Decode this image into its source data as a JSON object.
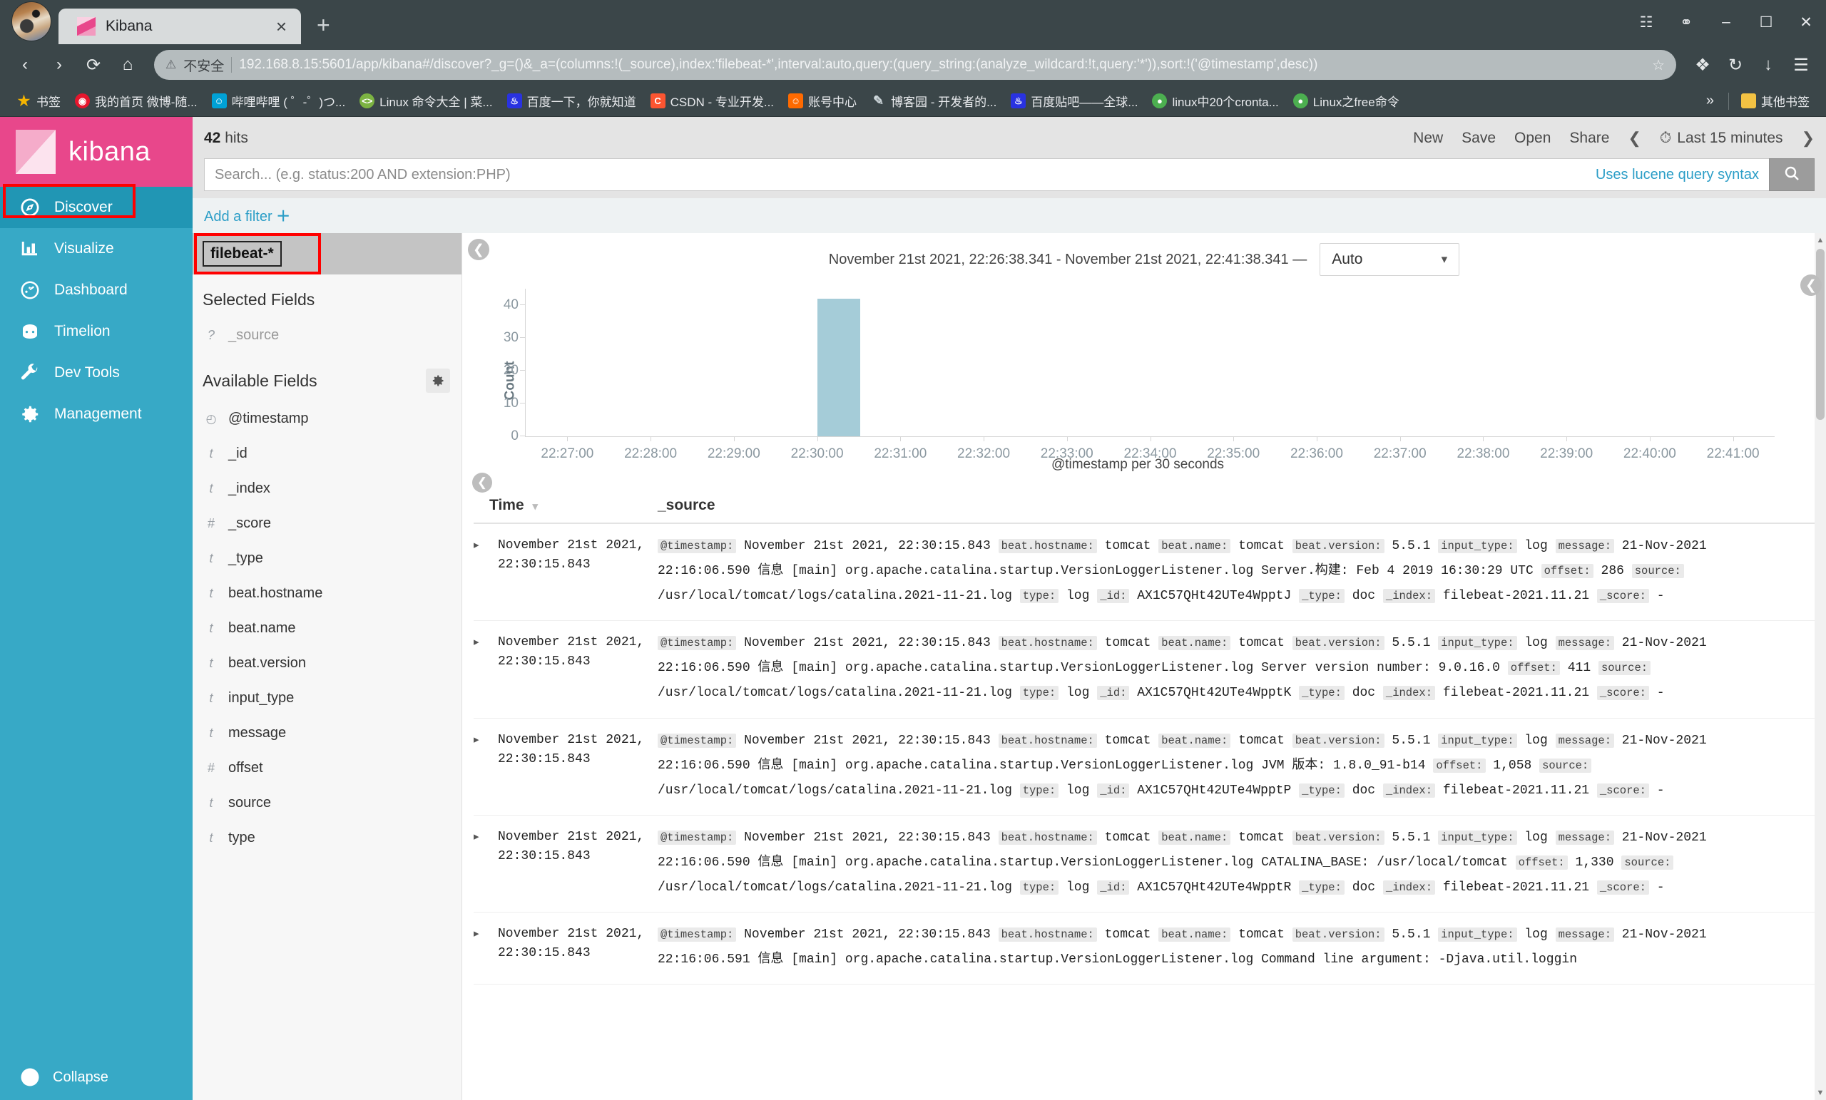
{
  "browser": {
    "tab": {
      "title": "Kibana",
      "favicon": "kibana-icon",
      "close": "×"
    },
    "newtab": "+",
    "window_controls": [
      "minimize",
      "maximize",
      "close"
    ],
    "nav": {
      "back": "‹",
      "forward": "›",
      "reload": "⟳",
      "home": "⌂"
    },
    "omnibox": {
      "warning_icon": "warning-triangle-icon",
      "insecure_label": "不安全",
      "url": "192.168.8.15:5601/app/kibana#/discover?_g=()&_a=(columns:!(_source),index:'filebeat-*',interval:auto,query:(query_string:(analyze_wildcard:!t,query:'*')),sort:!('@timestamp',desc))",
      "star_icon": "bookmark-star-icon"
    },
    "toolbar_right": [
      "cast-icon",
      "shield-icon",
      "extensions-icon",
      "menu-icon"
    ],
    "bookmarks": [
      {
        "label": "书签",
        "icon": "star-icon",
        "color": "#f5b400"
      },
      {
        "label": "我的首页 微博-随...",
        "icon": "weibo-icon",
        "color": "#e6162d"
      },
      {
        "label": "哔哩哔哩 ( ゜-゜)つ...",
        "icon": "bilibili-icon",
        "color": "#00a1d6"
      },
      {
        "label": "Linux 命令大全 | 菜...",
        "icon": "code-icon",
        "color": "#7cb342"
      },
      {
        "label": "百度一下，你就知道",
        "icon": "baidu-icon",
        "color": "#2932e1"
      },
      {
        "label": "CSDN - 专业开发...",
        "icon": "csdn-icon",
        "color": "#fc5531"
      },
      {
        "label": "账号中心",
        "icon": "account-icon",
        "color": "#ff6a00"
      },
      {
        "label": "博客园 - 开发者的...",
        "icon": "cnblogs-icon",
        "color": "#2b5f8e"
      },
      {
        "label": "百度贴吧——全球...",
        "icon": "baidu-tieba-icon",
        "color": "#2932e1"
      },
      {
        "label": "linux中20个cronta...",
        "icon": "leaf-icon",
        "color": "#4caf50"
      },
      {
        "label": "Linux之free命令",
        "icon": "leaf-icon",
        "color": "#4caf50"
      }
    ],
    "bookmarks_overflow": "»",
    "other_bookmarks": {
      "label": "其他书签",
      "icon": "folder-icon"
    }
  },
  "sidebar": {
    "logo_text": "kibana",
    "items": [
      {
        "label": "Discover",
        "icon": "compass-icon",
        "active": true
      },
      {
        "label": "Visualize",
        "icon": "bar-chart-icon",
        "active": false
      },
      {
        "label": "Dashboard",
        "icon": "dashboard-icon",
        "active": false
      },
      {
        "label": "Timelion",
        "icon": "timelion-icon",
        "active": false
      },
      {
        "label": "Dev Tools",
        "icon": "wrench-icon",
        "active": false
      },
      {
        "label": "Management",
        "icon": "gear-icon",
        "active": false
      }
    ],
    "collapse": {
      "label": "Collapse",
      "icon": "collapse-arrow-icon"
    }
  },
  "topbar": {
    "hits_count": "42",
    "hits_label": "hits",
    "actions": [
      "New",
      "Save",
      "Open",
      "Share"
    ],
    "time_prev": "❮",
    "time_next": "❯",
    "time_label": "Last 15 minutes",
    "clock_icon": "clock-icon"
  },
  "query": {
    "placeholder": "Search... (e.g. status:200 AND extension:PHP)",
    "value": "",
    "hint": "Uses lucene query syntax",
    "search_icon": "search-icon"
  },
  "filters": {
    "add_filter": "Add a filter",
    "plus": "＋"
  },
  "fields": {
    "index_pattern": "filebeat-*",
    "selected_title": "Selected Fields",
    "selected": [
      {
        "name": "_source",
        "type": "?"
      }
    ],
    "available_title": "Available Fields",
    "settings_icon": "gear-icon",
    "available": [
      {
        "name": "@timestamp",
        "type": "◴"
      },
      {
        "name": "_id",
        "type": "t"
      },
      {
        "name": "_index",
        "type": "t"
      },
      {
        "name": "_score",
        "type": "#"
      },
      {
        "name": "_type",
        "type": "t"
      },
      {
        "name": "beat.hostname",
        "type": "t"
      },
      {
        "name": "beat.name",
        "type": "t"
      },
      {
        "name": "beat.version",
        "type": "t"
      },
      {
        "name": "input_type",
        "type": "t"
      },
      {
        "name": "message",
        "type": "t"
      },
      {
        "name": "offset",
        "type": "#"
      },
      {
        "name": "source",
        "type": "t"
      },
      {
        "name": "type",
        "type": "t"
      }
    ]
  },
  "chart_header": {
    "range": "November 21st 2021, 22:26:38.341 - November 21st 2021, 22:41:38.341 —",
    "interval_value": "Auto",
    "interval_caret": "⌄"
  },
  "chart_data": {
    "type": "bar",
    "title": "",
    "xlabel": "@timestamp per 30 seconds",
    "ylabel": "Count",
    "ylim": [
      0,
      45
    ],
    "yticks": [
      0,
      10,
      20,
      30,
      40
    ],
    "grid": false,
    "legend": "none",
    "categories": [
      "22:27:00",
      "22:28:00",
      "22:29:00",
      "22:30:00",
      "22:31:00",
      "22:32:00",
      "22:33:00",
      "22:34:00",
      "22:35:00",
      "22:36:00",
      "22:37:00",
      "22:38:00",
      "22:39:00",
      "22:40:00",
      "22:41:00"
    ],
    "bar_color": "#a5ccd8",
    "bars": [
      {
        "x": "22:30:00",
        "value": 42
      }
    ],
    "values": [
      0,
      0,
      0,
      42,
      0,
      0,
      0,
      0,
      0,
      0,
      0,
      0,
      0,
      0,
      0
    ]
  },
  "doctable": {
    "columns": [
      "Time",
      "_source"
    ],
    "sort_caret": "▾",
    "expand_caret": "▸",
    "rows": [
      {
        "time": "November 21st 2021, 22:30:15.843",
        "source": [
          {
            "k": "@timestamp:",
            "v": "November 21st 2021, 22:30:15.843"
          },
          {
            "k": "beat.hostname:",
            "v": "tomcat"
          },
          {
            "k": "beat.name:",
            "v": "tomcat"
          },
          {
            "k": "beat.version:",
            "v": "5.5.1"
          },
          {
            "k": "input_type:",
            "v": "log"
          },
          {
            "k": "message:",
            "v": "21-Nov-2021 22:16:06.590 信息 [main] org.apache.catalina.startup.VersionLoggerListener.log Server.构建: Feb 4 2019 16:30:29 UTC"
          },
          {
            "k": "offset:",
            "v": "286"
          },
          {
            "k": "source:",
            "v": "/usr/local/tomcat/logs/catalina.2021-11-21.log"
          },
          {
            "k": "type:",
            "v": "log"
          },
          {
            "k": "_id:",
            "v": "AX1C57QHt42UTe4WpptJ"
          },
          {
            "k": "_type:",
            "v": "doc"
          },
          {
            "k": "_index:",
            "v": "filebeat-2021.11.21"
          },
          {
            "k": "_score:",
            "v": "-"
          }
        ]
      },
      {
        "time": "November 21st 2021, 22:30:15.843",
        "source": [
          {
            "k": "@timestamp:",
            "v": "November 21st 2021, 22:30:15.843"
          },
          {
            "k": "beat.hostname:",
            "v": "tomcat"
          },
          {
            "k": "beat.name:",
            "v": "tomcat"
          },
          {
            "k": "beat.version:",
            "v": "5.5.1"
          },
          {
            "k": "input_type:",
            "v": "log"
          },
          {
            "k": "message:",
            "v": "21-Nov-2021 22:16:06.590 信息 [main] org.apache.catalina.startup.VersionLoggerListener.log Server version number: 9.0.16.0"
          },
          {
            "k": "offset:",
            "v": "411"
          },
          {
            "k": "source:",
            "v": "/usr/local/tomcat/logs/catalina.2021-11-21.log"
          },
          {
            "k": "type:",
            "v": "log"
          },
          {
            "k": "_id:",
            "v": "AX1C57QHt42UTe4WpptK"
          },
          {
            "k": "_type:",
            "v": "doc"
          },
          {
            "k": "_index:",
            "v": "filebeat-2021.11.21"
          },
          {
            "k": "_score:",
            "v": "-"
          }
        ]
      },
      {
        "time": "November 21st 2021, 22:30:15.843",
        "source": [
          {
            "k": "@timestamp:",
            "v": "November 21st 2021, 22:30:15.843"
          },
          {
            "k": "beat.hostname:",
            "v": "tomcat"
          },
          {
            "k": "beat.name:",
            "v": "tomcat"
          },
          {
            "k": "beat.version:",
            "v": "5.5.1"
          },
          {
            "k": "input_type:",
            "v": "log"
          },
          {
            "k": "message:",
            "v": "21-Nov-2021 22:16:06.590 信息 [main] org.apache.catalina.startup.VersionLoggerListener.log JVM 版本: 1.8.0_91-b14"
          },
          {
            "k": "offset:",
            "v": "1,058"
          },
          {
            "k": "source:",
            "v": "/usr/local/tomcat/logs/catalina.2021-11-21.log"
          },
          {
            "k": "type:",
            "v": "log"
          },
          {
            "k": "_id:",
            "v": "AX1C57QHt42UTe4WpptP"
          },
          {
            "k": "_type:",
            "v": "doc"
          },
          {
            "k": "_index:",
            "v": "filebeat-2021.11.21"
          },
          {
            "k": "_score:",
            "v": "-"
          }
        ]
      },
      {
        "time": "November 21st 2021, 22:30:15.843",
        "source": [
          {
            "k": "@timestamp:",
            "v": "November 21st 2021, 22:30:15.843"
          },
          {
            "k": "beat.hostname:",
            "v": "tomcat"
          },
          {
            "k": "beat.name:",
            "v": "tomcat"
          },
          {
            "k": "beat.version:",
            "v": "5.5.1"
          },
          {
            "k": "input_type:",
            "v": "log"
          },
          {
            "k": "message:",
            "v": "21-Nov-2021 22:16:06.590 信息 [main] org.apache.catalina.startup.VersionLoggerListener.log CATALINA_BASE: /usr/local/tomcat"
          },
          {
            "k": "offset:",
            "v": "1,330"
          },
          {
            "k": "source:",
            "v": "/usr/local/tomcat/logs/catalina.2021-11-21.log"
          },
          {
            "k": "type:",
            "v": "log"
          },
          {
            "k": "_id:",
            "v": "AX1C57QHt42UTe4WpptR"
          },
          {
            "k": "_type:",
            "v": "doc"
          },
          {
            "k": "_index:",
            "v": "filebeat-2021.11.21"
          },
          {
            "k": "_score:",
            "v": "-"
          }
        ]
      },
      {
        "time": "November 21st 2021, 22:30:15.843",
        "source": [
          {
            "k": "@timestamp:",
            "v": "November 21st 2021, 22:30:15.843"
          },
          {
            "k": "beat.hostname:",
            "v": "tomcat"
          },
          {
            "k": "beat.name:",
            "v": "tomcat"
          },
          {
            "k": "beat.version:",
            "v": "5.5.1"
          },
          {
            "k": "input_type:",
            "v": "log"
          },
          {
            "k": "message:",
            "v": "21-Nov-2021 22:16:06.591 信息 [main] org.apache.catalina.startup.VersionLoggerListener.log Command line argument: -Djava.util.loggin"
          }
        ]
      }
    ]
  }
}
